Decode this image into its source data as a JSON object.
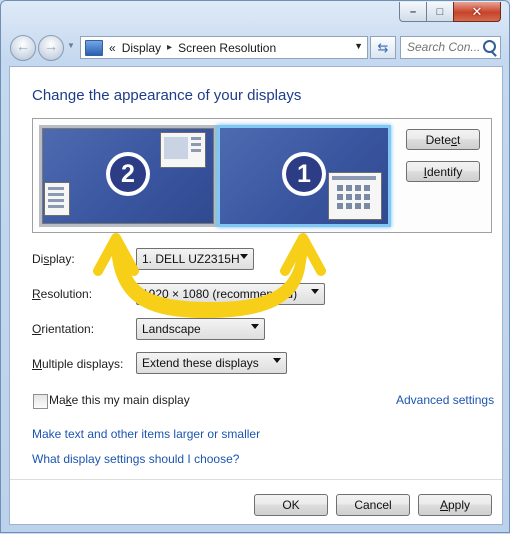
{
  "window": {
    "controls": {
      "minimize_icon": "minimize-icon",
      "maximize_icon": "maximize-icon",
      "close_icon": "close-icon"
    }
  },
  "nav": {
    "back_icon": "back-arrow-icon",
    "forward_icon": "forward-arrow-icon",
    "breadcrumb_prefix": "«",
    "breadcrumb": [
      "Display",
      "Screen Resolution"
    ],
    "separator": "▸",
    "search_placeholder": "Search Con..."
  },
  "page": {
    "title": "Change the appearance of your displays",
    "monitors": [
      {
        "number": "2",
        "selected": false
      },
      {
        "number": "1",
        "selected": true
      }
    ],
    "buttons": {
      "detect": {
        "before": "Dete",
        "accel": "c",
        "after": "t"
      },
      "identify": {
        "before": "",
        "accel": "I",
        "after": "dentify"
      }
    },
    "fields": {
      "display": {
        "label_before": "Di",
        "label_accel": "s",
        "label_after": "play:",
        "value": "1. DELL UZ2315H"
      },
      "resolution": {
        "label_before": "",
        "label_accel": "R",
        "label_after": "esolution:",
        "value": "1920 × 1080 (recommended)"
      },
      "orientation": {
        "label_before": "",
        "label_accel": "O",
        "label_after": "rientation:",
        "value": "Landscape"
      },
      "multiple": {
        "label_before": "",
        "label_accel": "M",
        "label_after": "ultiple displays:",
        "value": "Extend these displays"
      }
    },
    "main_display": {
      "before": "Ma",
      "accel": "k",
      "after": "e this my main display",
      "checked": false
    },
    "links": {
      "advanced": "Advanced settings",
      "text_size": "Make text and other items larger or smaller",
      "which_settings": "What display settings should I choose?"
    },
    "footer": {
      "ok": "OK",
      "cancel": "Cancel",
      "apply_before": "",
      "apply_accel": "A",
      "apply_after": "pply"
    }
  },
  "annotation": {
    "arrow_color": "#f7cf18",
    "meaning": "swap-arrows-icon"
  }
}
